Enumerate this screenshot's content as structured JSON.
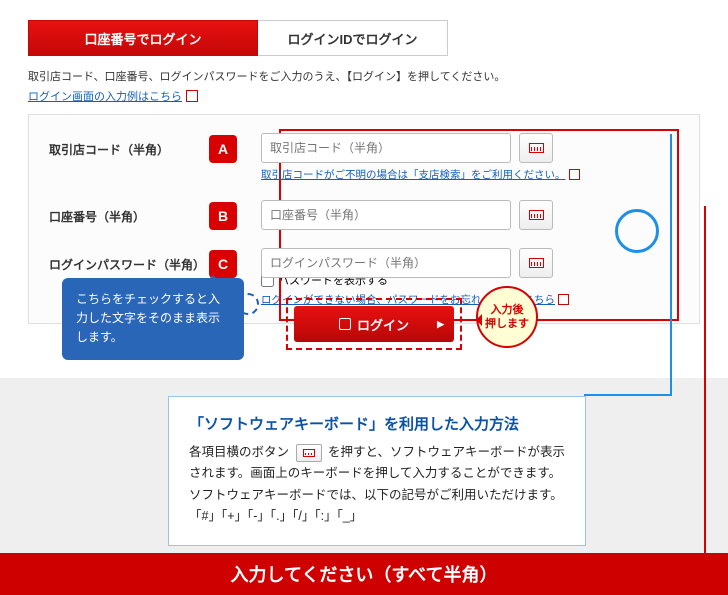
{
  "tabs": {
    "active": "口座番号でログイン",
    "inactive": "ログインIDでログイン"
  },
  "instructions": "取引店コード、口座番号、ログインパスワードをご入力のうえ、【ログイン】を押してください。",
  "example_link": "ログイン画面の入力例はこちら",
  "rows": {
    "a": {
      "label": "取引店コード（半角）",
      "letter": "A",
      "ph": "取引店コード（半角）",
      "hint": "取引店コードがご不明の場合は「支店検索」をご利用ください。"
    },
    "b": {
      "label": "口座番号（半角）",
      "letter": "B",
      "ph": "口座番号（半角）"
    },
    "c": {
      "label": "ログインパスワード（半角）",
      "letter": "C",
      "ph": "ログインパスワード（半角）",
      "show_pw": "パスワードを表示する",
      "forgot": "ログインができない場合、パスワードをお忘れの場合はこちら"
    }
  },
  "tooltip_blue": "こちらをチェックすると入力した文字をそのまま表示します。",
  "login_btn": "ログイン",
  "press_bubble": "入力後\n押します",
  "sw": {
    "title": "「ソフトウェアキーボード」を利用した入力方法",
    "p1a": "各項目横のボタン",
    "p1b": "を押すと、ソフトウェアキーボードが表示されます。画面上のキーボードを押して入力することができます。",
    "p2": "ソフトウェアキーボードでは、以下の記号がご利用いただけます。",
    "sym": "「#」「+」「-」「.」「/」「:」「_」"
  },
  "bottom_bar": "入力してください（すべて半角）"
}
